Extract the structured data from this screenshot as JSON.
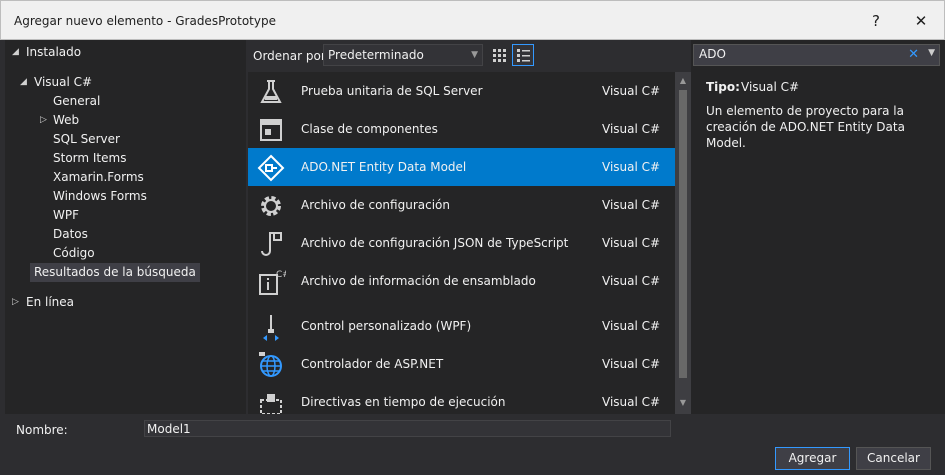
{
  "window": {
    "title": "Agregar nuevo elemento - GradesPrototype",
    "help_glyph": "?",
    "close_glyph": "✕"
  },
  "tree": {
    "installed": "Instalado",
    "visual_cs": "Visual C#",
    "items": [
      "General",
      "Web",
      "SQL Server",
      "Storm Items",
      "Xamarin.Forms",
      "Windows Forms",
      "WPF",
      "Datos",
      "Código"
    ],
    "search_results": "Resultados de la búsqueda",
    "online": "En línea"
  },
  "toolbar": {
    "sort_label": "Ordenar por:",
    "sort_value": "Predeterminado"
  },
  "templates": [
    {
      "name": "Prueba unitaria de SQL Server",
      "lang": "Visual C#",
      "icon": "flask-icon"
    },
    {
      "name": "Clase de componentes",
      "lang": "Visual C#",
      "icon": "component-icon"
    },
    {
      "name": "ADO.NET Entity Data Model",
      "lang": "Visual C#",
      "icon": "entity-model-icon"
    },
    {
      "name": "Archivo de configuración",
      "lang": "Visual C#",
      "icon": "gear-icon"
    },
    {
      "name": "Archivo de configuración JSON de TypeScript",
      "lang": "Visual C#",
      "icon": "json-config-icon"
    },
    {
      "name": "Archivo de información de ensamblado",
      "lang": "Visual C#",
      "icon": "assembly-info-icon"
    },
    {
      "name": "Control personalizado (WPF)",
      "lang": "Visual C#",
      "icon": "custom-control-icon"
    },
    {
      "name": "Controlador de ASP.NET",
      "lang": "Visual C#",
      "icon": "globe-icon"
    },
    {
      "name": "Directivas en tiempo de ejecución",
      "lang": "Visual C#",
      "icon": "directives-icon"
    }
  ],
  "search": {
    "value": "ADO",
    "clear_glyph": "✕"
  },
  "details": {
    "type_label": "Tipo:",
    "type_value": "Visual C#",
    "description": "Un elemento de proyecto para la creación de ADO.NET Entity Data Model."
  },
  "name_field": {
    "label": "Nombre:",
    "value": "Model1"
  },
  "buttons": {
    "add": "Agregar",
    "cancel": "Cancelar"
  },
  "colors": {
    "accent": "#007acc",
    "background": "#2d2d30",
    "panel": "#252526"
  }
}
